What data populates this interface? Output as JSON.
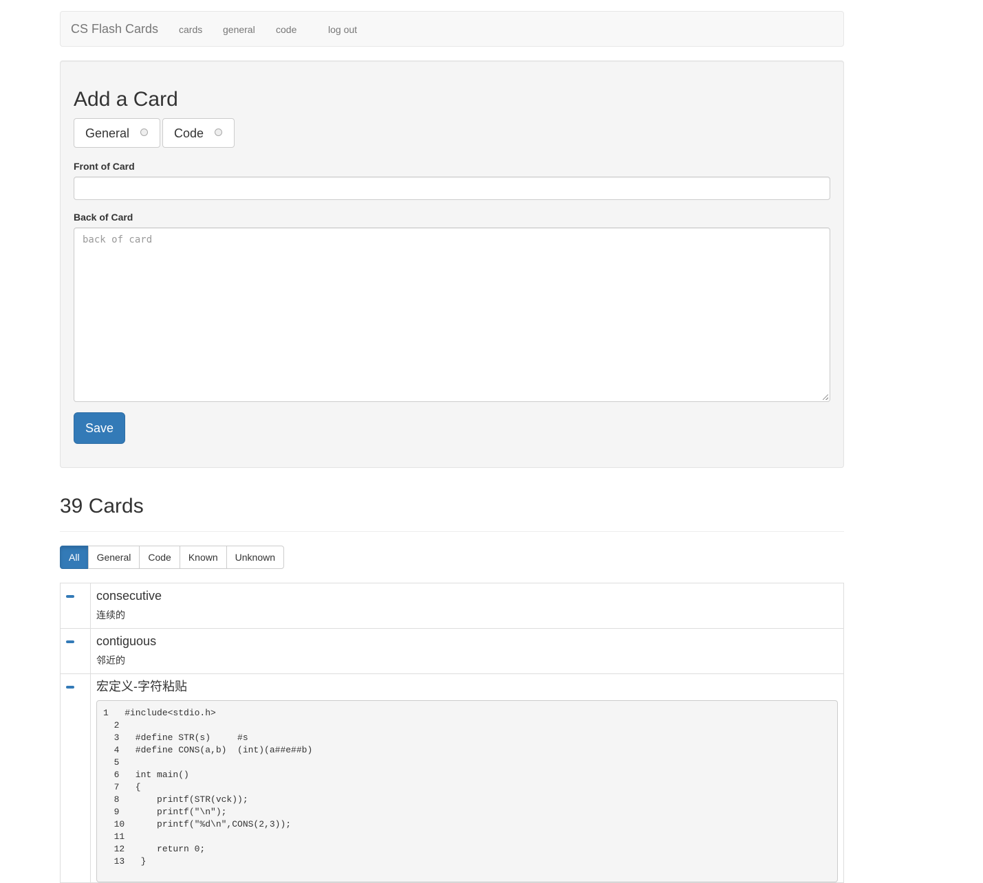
{
  "navbar": {
    "brand": "CS Flash Cards",
    "links": [
      "cards",
      "general",
      "code",
      "log out"
    ]
  },
  "add_card": {
    "title": "Add a Card",
    "types": [
      "General",
      "Code"
    ],
    "front_label": "Front of Card",
    "front_value": "",
    "back_label": "Back of Card",
    "back_placeholder": "back of card",
    "save_label": "Save"
  },
  "cards_section": {
    "heading": "39 Cards",
    "filters": [
      "All",
      "General",
      "Code",
      "Known",
      "Unknown"
    ],
    "active_filter": "All",
    "cards": [
      {
        "front": "consecutive",
        "back": "连续的"
      },
      {
        "front": "contiguous",
        "back": "邻近的"
      },
      {
        "front": "宏定义-字符粘贴",
        "code": "1   #include<stdio.h>\n  2\n  3   #define STR(s)     #s\n  4   #define CONS(a,b)  (int)(a##e##b)\n  5\n  6   int main()\n  7   {\n  8       printf(STR(vck));\n  9       printf(\"\\n\");\n  10      printf(\"%d\\n\",CONS(2,3));\n  11\n  12      return 0;\n  13   }"
      }
    ]
  },
  "colors": {
    "primary": "#337ab7",
    "well_bg": "#f5f5f5",
    "navbar_bg": "#f8f8f8"
  }
}
